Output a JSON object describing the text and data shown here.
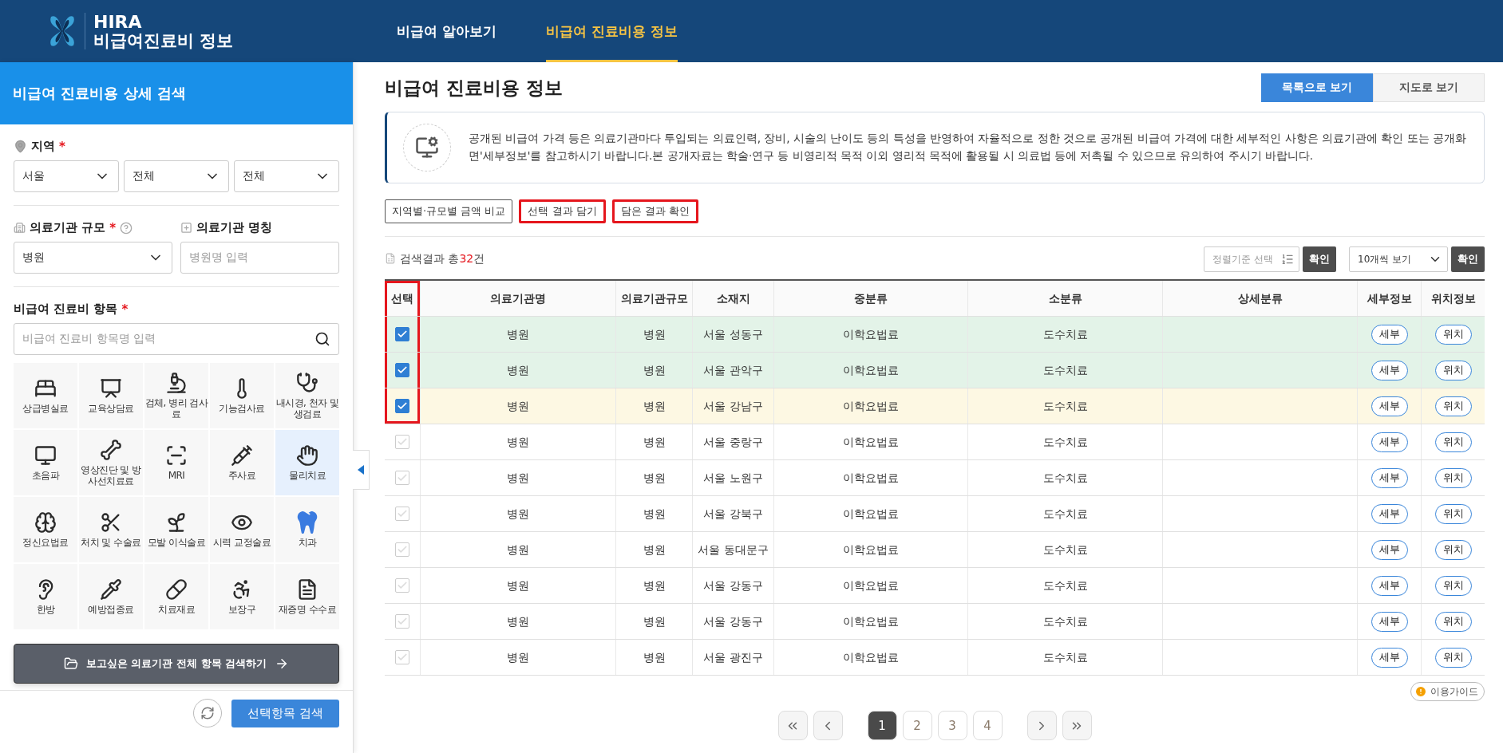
{
  "header": {
    "logo_title": "HIRA",
    "logo_subtitle": "비급여진료비 정보",
    "nav": [
      {
        "label": "비급여 알아보기",
        "selected": false
      },
      {
        "label": "비급여 진료비용 정보",
        "selected": true
      }
    ]
  },
  "sidebar": {
    "title": "비급여 진료비용 상세 검색",
    "region": {
      "label": "지역",
      "required_mark": "*",
      "selects": [
        "서울",
        "전체",
        "전체"
      ]
    },
    "scale": {
      "label": "의료기관 규모",
      "required_mark": "*",
      "value": "병원"
    },
    "name_field": {
      "label": "의료기관 명칭",
      "placeholder": "병원명 입력"
    },
    "items": {
      "label": "비급여 진료비 항목",
      "required_mark": "*",
      "placeholder": "비급여 진료비 항목명 입력"
    },
    "categories": [
      {
        "label": "상급병실료",
        "selected": false
      },
      {
        "label": "교육상담료",
        "selected": false
      },
      {
        "label": "검체, 병리 검사료",
        "selected": false
      },
      {
        "label": "기능검사료",
        "selected": false
      },
      {
        "label": "내시경, 천자 및 생검료",
        "selected": false
      },
      {
        "label": "초음파",
        "selected": false
      },
      {
        "label": "영상진단 및 방사선치료료",
        "selected": false
      },
      {
        "label": "MRI",
        "selected": false
      },
      {
        "label": "주사료",
        "selected": false
      },
      {
        "label": "물리치료",
        "selected": true
      },
      {
        "label": "정신요법료",
        "selected": false
      },
      {
        "label": "처치 및 수술료",
        "selected": false
      },
      {
        "label": "모발 이식술료",
        "selected": false
      },
      {
        "label": "시력 교정술료",
        "selected": false
      },
      {
        "label": "치과",
        "selected": false
      },
      {
        "label": "한방",
        "selected": false
      },
      {
        "label": "예방접종료",
        "selected": false
      },
      {
        "label": "치료재료",
        "selected": false
      },
      {
        "label": "보장구",
        "selected": false
      },
      {
        "label": "재증명 수수료",
        "selected": false
      }
    ],
    "all_search_button": "보고싶은 의료기관 전체 항목 검색하기",
    "search_button": "선택항목 검색"
  },
  "main": {
    "title": "비급여 진료비용 정보",
    "view_toggle": [
      {
        "label": "목록으로 보기",
        "selected": true
      },
      {
        "label": "지도로 보기",
        "selected": false
      }
    ],
    "notice": "공개된 비급여 가격 등은 의료기관마다 투입되는 의료인력, 장비, 시술의 난이도 등의 특성을 반영하여 자율적으로 정한 것으로 공개된 비급여 가격에 대한 세부적인 사항은 의료기관에 확인 또는 공개화면'세부정보'를 참고하시기 바랍니다.본 공개자료는 학술·연구 등 비영리적 목적 이외 영리적 목적에 활용될 시 의료법 등에 저촉될 수 있으므로 유의하여 주시기 바랍니다.",
    "actions": [
      {
        "label": "지역별·규모별 금액 비교",
        "highlighted": false
      },
      {
        "label": "선택 결과 담기",
        "highlighted": true
      },
      {
        "label": "담은 결과 확인",
        "highlighted": true
      }
    ],
    "result_count": {
      "prefix": "검색결과 총",
      "count": "32",
      "suffix": "건"
    },
    "sort": {
      "placeholder": "정렬기준 선택",
      "confirm": "확인"
    },
    "page_size": {
      "value": "10개씩 보기",
      "confirm": "확인"
    },
    "table": {
      "columns": [
        {
          "label": "선택",
          "highlighted": true
        },
        {
          "label": "의료기관명",
          "highlighted": false
        },
        {
          "label": "의료기관규모",
          "highlighted": false
        },
        {
          "label": "소재지",
          "highlighted": false
        },
        {
          "label": "중분류",
          "highlighted": false
        },
        {
          "label": "소분류",
          "highlighted": false
        },
        {
          "label": "상세분류",
          "highlighted": false
        },
        {
          "label": "세부정보",
          "highlighted": false
        },
        {
          "label": "위치정보",
          "highlighted": false
        }
      ],
      "rows": [
        {
          "checked": true,
          "hovered": false,
          "highlighted": true,
          "institution": "병원",
          "scale": "병원",
          "region": "서울 성동구",
          "mid_category": "이학요법료",
          "sub_category": "도수치료",
          "detail": "세부",
          "location": "위치"
        },
        {
          "checked": true,
          "hovered": false,
          "highlighted": true,
          "institution": "병원",
          "scale": "병원",
          "region": "서울 관악구",
          "mid_category": "이학요법료",
          "sub_category": "도수치료",
          "detail": "세부",
          "location": "위치"
        },
        {
          "checked": true,
          "hovered": true,
          "highlighted": true,
          "institution": "병원",
          "scale": "병원",
          "region": "서울 강남구",
          "mid_category": "이학요법료",
          "sub_category": "도수치료",
          "detail": "세부",
          "location": "위치"
        },
        {
          "checked": false,
          "hovered": false,
          "highlighted": false,
          "institution": "병원",
          "scale": "병원",
          "region": "서울 중랑구",
          "mid_category": "이학요법료",
          "sub_category": "도수치료",
          "detail": "세부",
          "location": "위치"
        },
        {
          "checked": false,
          "hovered": false,
          "highlighted": false,
          "institution": "병원",
          "scale": "병원",
          "region": "서울 노원구",
          "mid_category": "이학요법료",
          "sub_category": "도수치료",
          "detail": "세부",
          "location": "위치"
        },
        {
          "checked": false,
          "hovered": false,
          "highlighted": false,
          "institution": "병원",
          "scale": "병원",
          "region": "서울 강북구",
          "mid_category": "이학요법료",
          "sub_category": "도수치료",
          "detail": "세부",
          "location": "위치"
        },
        {
          "checked": false,
          "hovered": false,
          "highlighted": false,
          "institution": "병원",
          "scale": "병원",
          "region": "서울 동대문구",
          "mid_category": "이학요법료",
          "sub_category": "도수치료",
          "detail": "세부",
          "location": "위치"
        },
        {
          "checked": false,
          "hovered": false,
          "highlighted": false,
          "institution": "병원",
          "scale": "병원",
          "region": "서울 강동구",
          "mid_category": "이학요법료",
          "sub_category": "도수치료",
          "detail": "세부",
          "location": "위치"
        },
        {
          "checked": false,
          "hovered": false,
          "highlighted": false,
          "institution": "병원",
          "scale": "병원",
          "region": "서울 강동구",
          "mid_category": "이학요법료",
          "sub_category": "도수치료",
          "detail": "세부",
          "location": "위치"
        },
        {
          "checked": false,
          "hovered": false,
          "highlighted": false,
          "institution": "병원",
          "scale": "병원",
          "region": "서울 광진구",
          "mid_category": "이학요법료",
          "sub_category": "도수치료",
          "detail": "세부",
          "location": "위치"
        }
      ]
    },
    "guide": "이용가이드",
    "pagination": [
      {
        "label": "1",
        "selected": true
      },
      {
        "label": "2",
        "selected": false
      },
      {
        "label": "3",
        "selected": false
      },
      {
        "label": "4",
        "selected": false
      }
    ]
  }
}
